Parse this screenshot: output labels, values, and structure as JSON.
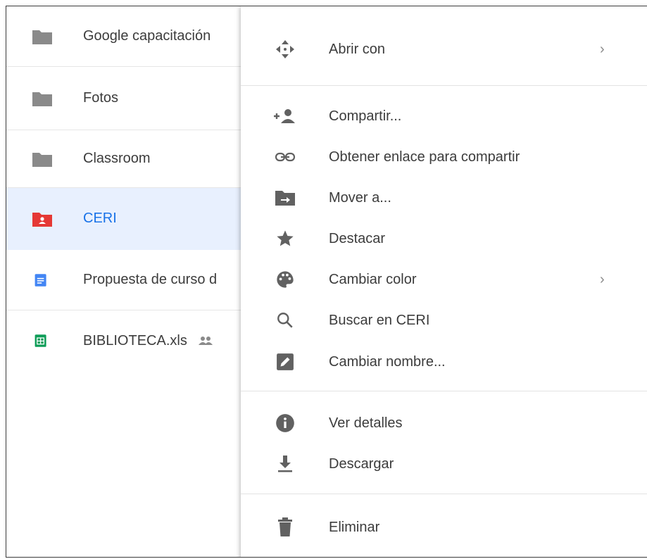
{
  "files": [
    {
      "name": "Google capacitación",
      "icon": "folder-icon",
      "color": "#8a8a8a",
      "selected": false
    },
    {
      "name": "Fotos",
      "icon": "folder-icon",
      "color": "#8a8a8a",
      "selected": false
    },
    {
      "name": "Classroom",
      "icon": "folder-icon",
      "color": "#8a8a8a",
      "selected": false
    },
    {
      "name": "CERI",
      "icon": "shared-folder-icon",
      "color": "#e53935",
      "selected": true
    },
    {
      "name": "Propuesta de curso d",
      "icon": "google-docs-icon",
      "color": "#4285f4",
      "selected": false
    },
    {
      "name": "BIBLIOTECA.xls",
      "icon": "google-sheets-icon",
      "color": "#0f9d58",
      "selected": false,
      "shared": true
    }
  ],
  "menu": {
    "open_with": {
      "label": "Abrir con",
      "icon": "open-with-icon"
    },
    "share": {
      "label": "Compartir...",
      "icon": "add-person-icon"
    },
    "get_link": {
      "label": "Obtener enlace para compartir",
      "icon": "link-icon"
    },
    "move_to": {
      "label": "Mover a...",
      "icon": "move-to-folder-icon"
    },
    "star": {
      "label": "Destacar",
      "icon": "star-icon"
    },
    "change_color": {
      "label": "Cambiar color",
      "icon": "palette-icon"
    },
    "search_in": {
      "label": "Buscar en CERI",
      "icon": "search-icon"
    },
    "rename": {
      "label": "Cambiar nombre...",
      "icon": "edit-icon"
    },
    "details": {
      "label": "Ver detalles",
      "icon": "info-icon"
    },
    "download": {
      "label": "Descargar",
      "icon": "download-icon"
    },
    "remove": {
      "label": "Eliminar",
      "icon": "trash-icon"
    },
    "submenu_arrow": "›"
  },
  "colors": {
    "icon_gray": "#616161",
    "selected_bg": "#e8f0fe",
    "selected_text": "#1a73e8"
  }
}
